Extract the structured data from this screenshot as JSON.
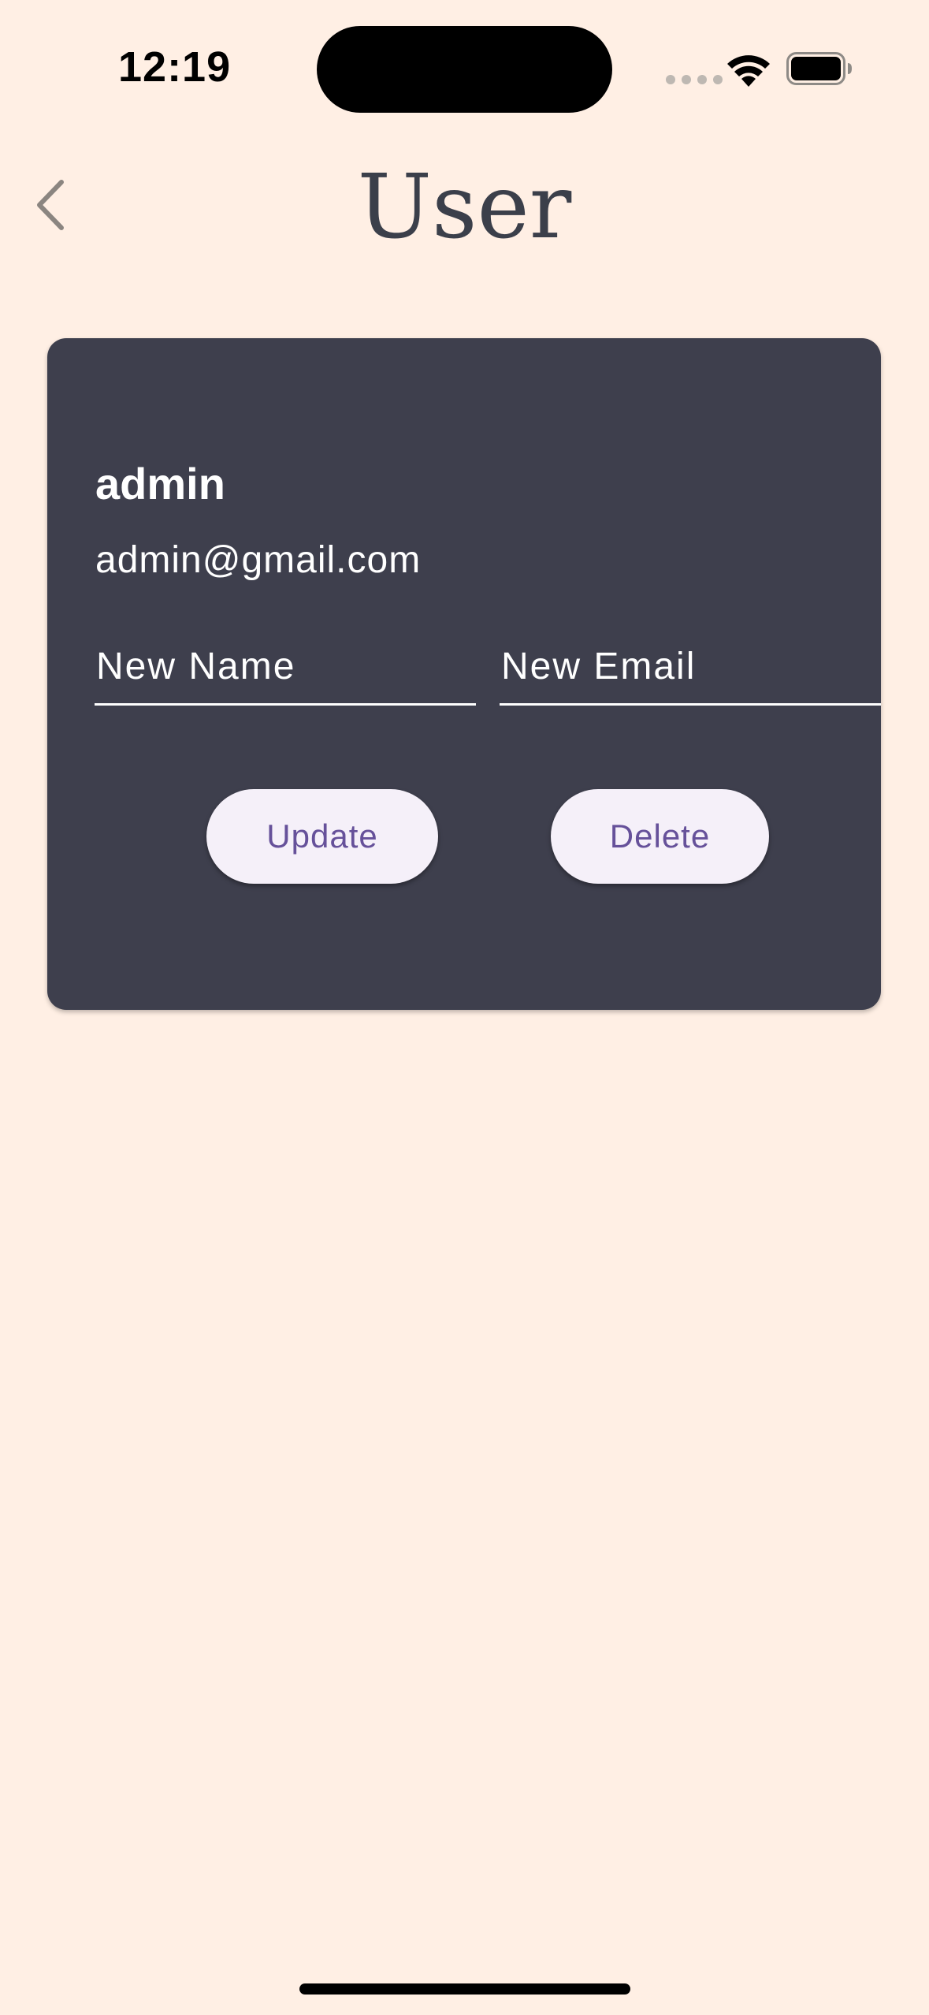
{
  "status_bar": {
    "time": "12:19"
  },
  "header": {
    "title": "User",
    "back_icon": "chevron-left-icon"
  },
  "user_card": {
    "name": "admin",
    "email": "admin@gmail.com",
    "new_name_field": {
      "placeholder": "New Name",
      "value": ""
    },
    "new_email_field": {
      "placeholder": "New Email",
      "value": ""
    },
    "update_label": "Update",
    "delete_label": "Delete"
  },
  "colors": {
    "background": "#FFEFE4",
    "card": "#3E3F4D",
    "title": "#3B3F4A",
    "button_bg": "#F5F0F9",
    "button_text": "#66519A"
  }
}
